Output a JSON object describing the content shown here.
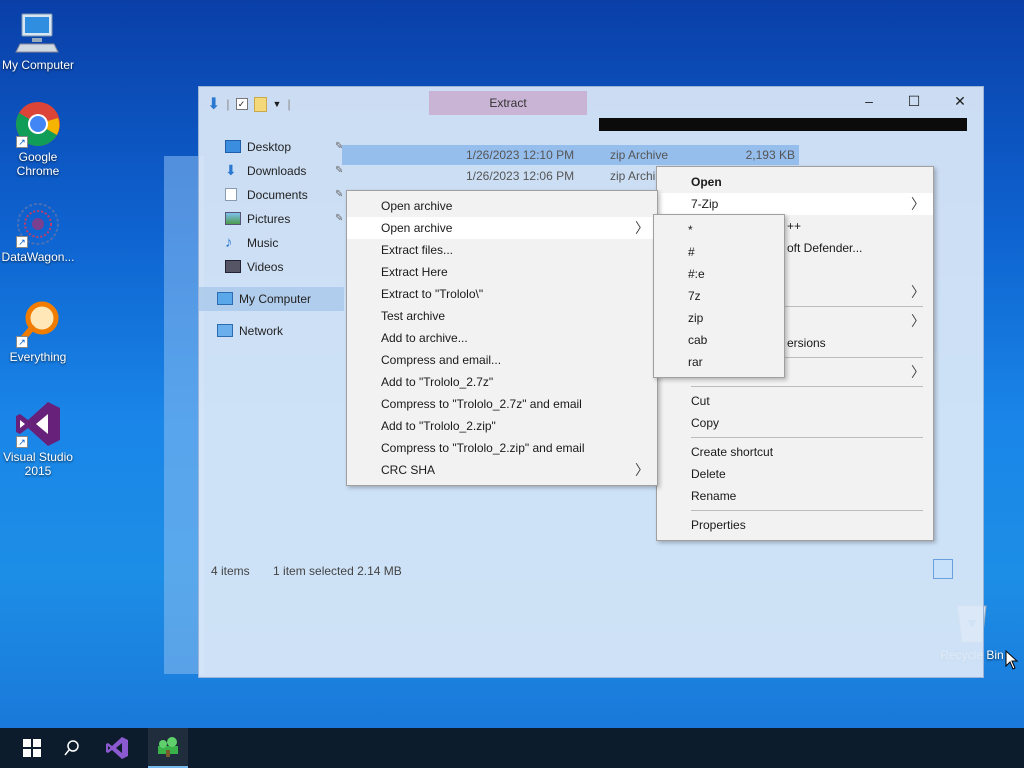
{
  "desktop": {
    "icons": [
      {
        "label": "My Computer"
      },
      {
        "label": "Google Chrome"
      },
      {
        "label": "DataWagon..."
      },
      {
        "label": "Everything"
      },
      {
        "label": "Visual Studio 2015"
      },
      {
        "label": "Recycle Bin"
      }
    ]
  },
  "window": {
    "title": "Extract",
    "controls": {
      "minimize": "–",
      "maximize": "☐",
      "close": "✕"
    }
  },
  "nav": {
    "items": [
      {
        "label": "Desktop"
      },
      {
        "label": "Downloads"
      },
      {
        "label": "Documents"
      },
      {
        "label": "Pictures"
      },
      {
        "label": "Music"
      },
      {
        "label": "Videos"
      },
      {
        "label": "My Computer"
      },
      {
        "label": "Network"
      }
    ]
  },
  "files": [
    {
      "date": "1/26/2023 12:10 PM",
      "type": "zip Archive",
      "size": "2,193 KB"
    },
    {
      "date": "1/26/2023 12:06 PM",
      "type": "zip Archi",
      "size": ""
    }
  ],
  "status": {
    "count": "4 items",
    "selection": "1 item selected  2.14 MB"
  },
  "context_menu": {
    "open": "Open",
    "seven_zip": "7-Zip",
    "partial_1": "++",
    "partial_2": "oft Defender...",
    "partial_3": "ersions",
    "cut": "Cut",
    "copy": "Copy",
    "create_shortcut": "Create shortcut",
    "delete": "Delete",
    "rename": "Rename",
    "properties": "Properties"
  },
  "zip_menu": {
    "items": [
      {
        "label": "Open archive",
        "arrow": false
      },
      {
        "label": "Open archive",
        "arrow": true
      },
      {
        "label": "Extract files...",
        "arrow": false
      },
      {
        "label": "Extract Here",
        "arrow": false
      },
      {
        "label": "Extract to \"Trololo\\\"",
        "arrow": false
      },
      {
        "label": "Test archive",
        "arrow": false
      },
      {
        "label": "Add to archive...",
        "arrow": false
      },
      {
        "label": "Compress and email...",
        "arrow": false
      },
      {
        "label": "Add to \"Trololo_2.7z\"",
        "arrow": false
      },
      {
        "label": "Compress to \"Trololo_2.7z\" and email",
        "arrow": false
      },
      {
        "label": "Add to \"Trololo_2.zip\"",
        "arrow": false
      },
      {
        "label": "Compress to \"Trololo_2.zip\" and email",
        "arrow": false
      },
      {
        "label": "CRC SHA",
        "arrow": true
      }
    ]
  },
  "open_archive_menu": {
    "items": [
      "*",
      "#",
      "#:e",
      "7z",
      "zip",
      "cab",
      "rar"
    ]
  },
  "colors": {
    "desktop_blue": "#1a86e8",
    "taskbar": "#0d1c2c",
    "menu_bg": "#f2f2f2",
    "selection": "#8cb9eb"
  }
}
